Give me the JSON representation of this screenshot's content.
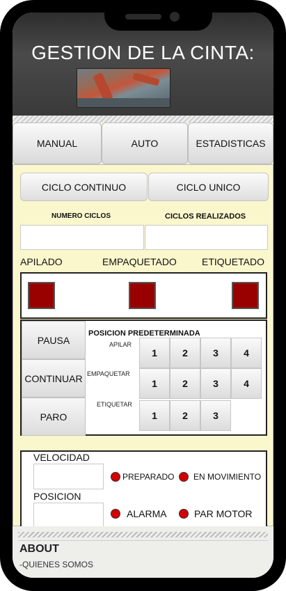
{
  "header": {
    "title": "GESTION DE LA CINTA:"
  },
  "tabs": [
    "MANUAL",
    "AUTO",
    "ESTADISTICAS"
  ],
  "mode": {
    "continuous": "CICLO CONTINUO",
    "single": "CICLO UNICO"
  },
  "counters": {
    "cycles_label": "NUMERO CICLOS",
    "done_label": "CICLOS REALIZADOS",
    "cycles_value": "",
    "done_value": ""
  },
  "stages": [
    "APILADO",
    "EMPAQUETADO",
    "ETIQUETADO"
  ],
  "controls": {
    "pause": "PAUSA",
    "continue": "CONTINUAR",
    "stop": "PARO"
  },
  "preset": {
    "title": "POSICION PREDETERMINADA",
    "rows": [
      {
        "label": "APILAR",
        "values": [
          "1",
          "2",
          "3",
          "4"
        ]
      },
      {
        "label": "EMPAQUETAR",
        "values": [
          "1",
          "2",
          "3",
          "4"
        ]
      },
      {
        "label": "ETIQUETAR",
        "values": [
          "1",
          "2",
          "3"
        ]
      }
    ]
  },
  "status": {
    "velocity_label": "VELOCIDAD",
    "position_label": "POSICION",
    "velocity_value": "",
    "position_value": "",
    "indicators": [
      "PREPARADO",
      "EN MOVIMIENTO",
      "ALARMA",
      "PAR MOTOR"
    ]
  },
  "footer": {
    "about": "ABOUT",
    "link": "-QUIENES SOMOS"
  },
  "colors": {
    "indicator": "#d40000",
    "stage_square": "#990000",
    "panel": "#fbf7cd"
  }
}
